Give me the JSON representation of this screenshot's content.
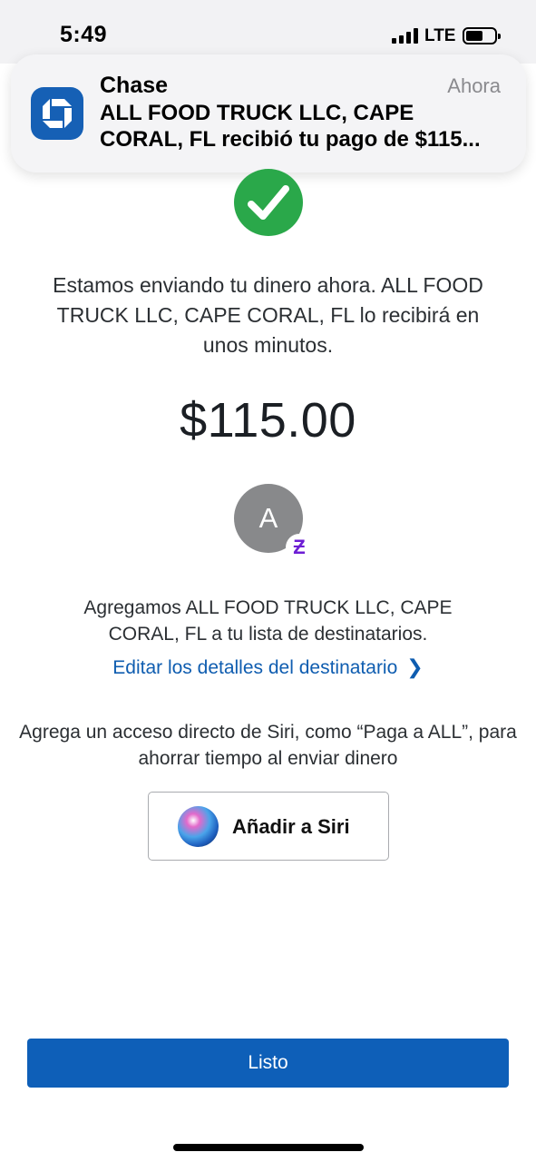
{
  "status_bar": {
    "time": "5:49",
    "network": "LTE",
    "signal_bars": 4,
    "battery_level": 0.6
  },
  "notification": {
    "app_name": "Chase",
    "time": "Ahora",
    "line1": "ALL FOOD TRUCK LLC, CAPE",
    "line2": "CORAL, FL recibió tu pago de $115...",
    "icon": "chase-logo-icon",
    "icon_color": "#1660b5"
  },
  "confirmation": {
    "icon": "check-circle-icon",
    "icon_color": "#2aa84a",
    "message": "Estamos enviando tu dinero ahora. ALL FOOD TRUCK LLC, CAPE CORAL, FL lo recibirá en unos minutos.",
    "amount": "$115.00"
  },
  "recipient": {
    "avatar_initial": "A",
    "badge_glyph": "Ƶ",
    "badge_icon": "zelle-icon",
    "badge_color": "#6d1ed4",
    "added_text": "Agregamos ALL FOOD TRUCK LLC, CAPE CORAL, FL a tu lista de destinatarios.",
    "edit_link": "Editar los detalles del destinatario"
  },
  "siri": {
    "text": "Agrega un acceso directo de Siri, como “Paga a ALL”, para ahorrar tiempo al enviar dinero",
    "button_label": "Añadir a Siri",
    "icon": "siri-icon"
  },
  "actions": {
    "done_label": "Listo",
    "accent_color": "#0e5fb8"
  }
}
